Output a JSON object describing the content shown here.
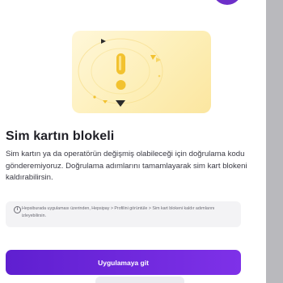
{
  "page": {
    "title": "Sim kartın blokeli",
    "description": "Sim kartın ya da operatörün değişmiş olabileceği için doğrulama kodu gönderemiyoruz. Doğrulama adımlarını tamamlayarak sim kart blokeni kaldırabilirsin.",
    "info_text": "Hepsiburada uygulaması üzerinden, Hepsipay > Profilini görüntüle > Sim kart blokeni kaldır adımlarını izleyebilirsin.",
    "info_glyph": "i",
    "primary_button_label": "Uygulamaya git"
  },
  "colors": {
    "accent": "#6d2fc9",
    "hero_background": "#fdefb8",
    "hero_marks": "#f2c230",
    "sheet_background": "#ffffff",
    "backdrop": "#b9b9bd"
  },
  "icons": {
    "hero": "sim-lock-illustration",
    "info": "info-circle-icon"
  }
}
